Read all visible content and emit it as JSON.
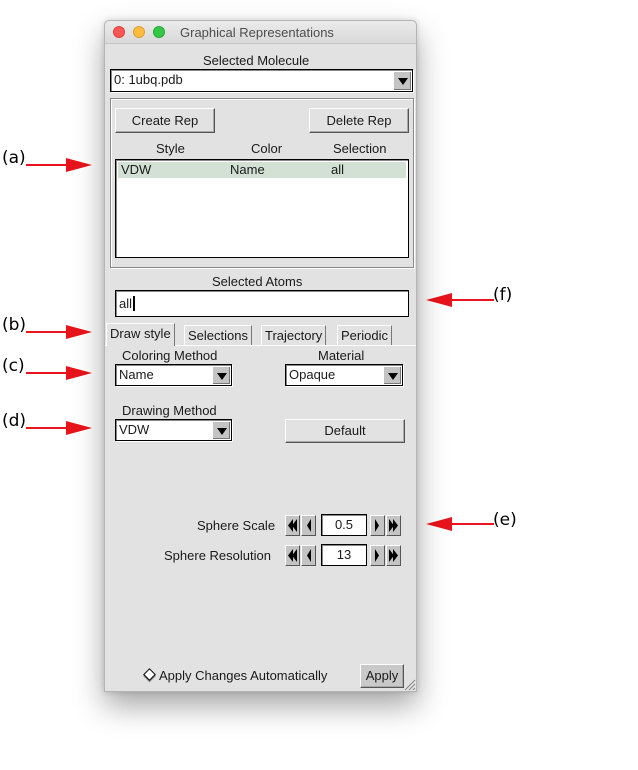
{
  "window": {
    "title": "Graphical Representations"
  },
  "molecule": {
    "label": "Selected Molecule",
    "selected": "0: 1ubq.pdb"
  },
  "reps": {
    "create_label": "Create Rep",
    "delete_label": "Delete Rep",
    "columns": [
      "Style",
      "Color",
      "Selection"
    ],
    "rows": [
      {
        "style": "VDW",
        "color": "Name",
        "selection": "all"
      }
    ],
    "selected_row_color": "#d3e1d4"
  },
  "atoms": {
    "label": "Selected Atoms",
    "value": "all"
  },
  "tabs": [
    {
      "label": "Draw style",
      "active": true
    },
    {
      "label": "Selections",
      "active": false
    },
    {
      "label": "Trajectory",
      "active": false
    },
    {
      "label": "Periodic",
      "active": false
    }
  ],
  "draw_style": {
    "coloring_label": "Coloring Method",
    "coloring_value": "Name",
    "material_label": "Material",
    "material_value": "Opaque",
    "drawing_label": "Drawing Method",
    "drawing_value": "VDW",
    "default_label": "Default",
    "sphere_scale_label": "Sphere Scale",
    "sphere_scale_value": "0.5",
    "sphere_resolution_label": "Sphere Resolution",
    "sphere_resolution_value": "13"
  },
  "footer": {
    "auto_apply_label": "Apply Changes Automatically",
    "apply_label": "Apply"
  },
  "annotations": {
    "a": "(a)",
    "b": "(b)",
    "c": "(c)",
    "d": "(d)",
    "e": "(e)",
    "f": "(f)",
    "arrow_color": "#e8141b"
  }
}
